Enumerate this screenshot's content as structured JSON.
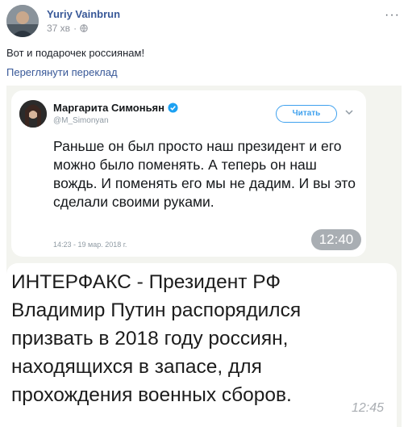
{
  "post": {
    "author": "Yuriy Vainbrun",
    "time": "37 хв",
    "audience_icon": "globe-icon",
    "text": "Вот и подарочек россиянам!",
    "translate_link": "Переглянути переклад",
    "more_icon": "ellipsis-icon",
    "more_label": "···"
  },
  "tweet": {
    "name": "Маргарита Симоньян",
    "handle": "@M_Simonyan",
    "follow_label": "Читать",
    "body": "Раньше он был просто наш президент и его можно было поменять. А теперь он наш вождь.  И поменять его мы не дадим. И вы это сделали своими руками.",
    "date": "14:23 - 19 мар. 2018 г.",
    "time_badge": "12:40"
  },
  "message": {
    "text": "ИНТЕРФАКС - Президент РФ Владимир Путин распорядился призвать в 2018 году россиян, находящихся в запасе, для прохождения военных сборов.",
    "time": "12:45"
  },
  "colors": {
    "link": "#385898",
    "twitter_blue": "#3fa1ee",
    "chat_bg": "#f3f4ef"
  }
}
